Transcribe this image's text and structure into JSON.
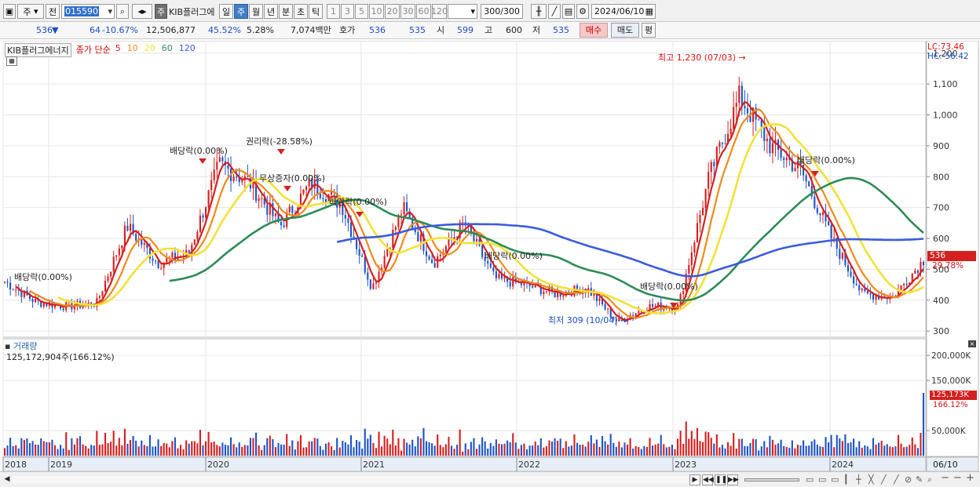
{
  "toolbar": {
    "period_type": "주",
    "compare": "전",
    "code": "015590",
    "stock_name": "KIB플러그에",
    "timeframes": [
      "일",
      "주",
      "월",
      "년",
      "분",
      "초",
      "틱"
    ],
    "active_timeframe": "주",
    "intervals": [
      "1",
      "3",
      "5",
      "10",
      "20",
      "30",
      "60",
      "120"
    ],
    "count": "300/300",
    "date": "2024/06/10"
  },
  "quote": {
    "price": "536",
    "change_arrow": "▼",
    "change": "64",
    "change_pct": "-10.67%",
    "volume": "12,506,877",
    "volume_ratio": "45.52%",
    "turnover": "5.28%",
    "amount": "7,074백만",
    "bid_label": "호가",
    "ask": "536",
    "bid": "535",
    "open_label": "시",
    "open": "599",
    "high_label": "고",
    "high": "600",
    "low_label": "저",
    "low": "535",
    "buy_label": "매수",
    "sell_label": "매도",
    "eval_label": "평"
  },
  "legend": {
    "name": "KIB플러그에너지",
    "price_label": "종가 단순",
    "ma_periods": [
      "5",
      "10",
      "20",
      "60",
      "120"
    ],
    "ma_colors": [
      "#d62020",
      "#f08a1c",
      "#f0e23a",
      "#2e8b57",
      "#3a5bdc"
    ]
  },
  "axis": {
    "price_ticks": [
      "1,200",
      "1,100",
      "1,000",
      "900",
      "800",
      "700",
      "600",
      "500",
      "400",
      "300"
    ],
    "lc": "LC:73.46",
    "hc": "HC:-56.42",
    "current_price_tag": "536",
    "current_pct_tag": "29.78%",
    "volume_ticks": [
      "200,000K",
      "150,000K",
      "50,000K"
    ],
    "current_volume_tag": "125,173K",
    "current_volume_pct": "166.12%",
    "years": [
      "2018",
      "2019",
      "2020",
      "2021",
      "2022",
      "2023",
      "2024"
    ],
    "last_date": "06/10"
  },
  "annotations": {
    "max": "최고 1,230 (07/03)",
    "min": "최저 309 (10/04)",
    "events": [
      "배당락(0.00%)",
      "배당락(0.00%)",
      "권리락(-28.58%)",
      "무상증자(0.00%)",
      "배당락(0.00%)",
      "배당락(0.00%)",
      "배당락(0.00%)",
      "배당락(0.00%)"
    ]
  },
  "volume_panel": {
    "title": "거래량",
    "value": "125,172,904주(166.12%)"
  },
  "chart_data": {
    "type": "line",
    "x": [
      "2018-01",
      "2018-06",
      "2018-10",
      "2019-01",
      "2019-03",
      "2019-05",
      "2019-08",
      "2019-11",
      "2020-01",
      "2020-03",
      "2020-05",
      "2020-07",
      "2020-09",
      "2020-11",
      "2021-01",
      "2021-04",
      "2021-07",
      "2021-10",
      "2022-01",
      "2022-04",
      "2022-07",
      "2022-10",
      "2023-01",
      "2023-04",
      "2023-07",
      "2023-09",
      "2023-11",
      "2024-01",
      "2024-02",
      "2024-04",
      "2024-06"
    ],
    "series": [
      {
        "name": "5",
        "values": [
          460,
          395,
          380,
          390,
          640,
          520,
          550,
          840,
          780,
          640,
          780,
          710,
          440,
          700,
          520,
          650,
          470,
          450,
          420,
          440,
          330,
          380,
          380,
          800,
          1060,
          900,
          820,
          600,
          420,
          410,
          530
        ]
      }
    ],
    "ylim": [
      280,
      1240
    ],
    "volume_max_k": 230000,
    "events": [
      {
        "label": "최고 1,230 (07/03)",
        "value": 1230
      },
      {
        "label": "최저 309 (10/04)",
        "value": 309
      }
    ]
  }
}
